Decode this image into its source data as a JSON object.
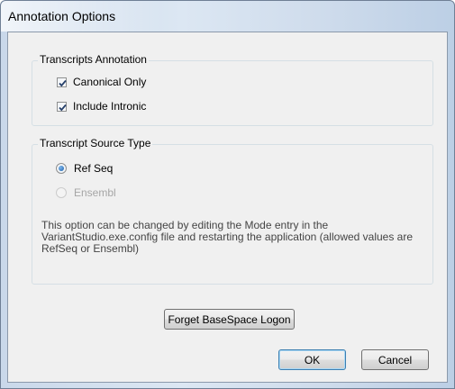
{
  "window": {
    "title": "Annotation Options"
  },
  "transcripts_annotation": {
    "label": "Transcripts Annotation",
    "canonical_only": {
      "label": "Canonical Only",
      "checked": true
    },
    "include_intronic": {
      "label": "Include Intronic",
      "checked": true
    }
  },
  "transcript_source_type": {
    "label": "Transcript Source Type",
    "options": [
      {
        "label": "Ref Seq",
        "selected": true,
        "enabled": true
      },
      {
        "label": "Ensembl",
        "selected": false,
        "enabled": false
      }
    ],
    "note": "This option can be changed by editing the Mode entry in the VariantStudio.exe.config file and restarting the application (allowed values are RefSeq or Ensembl)"
  },
  "buttons": {
    "forget_logon": "Forget BaseSpace Logon",
    "ok": "OK",
    "cancel": "Cancel"
  }
}
